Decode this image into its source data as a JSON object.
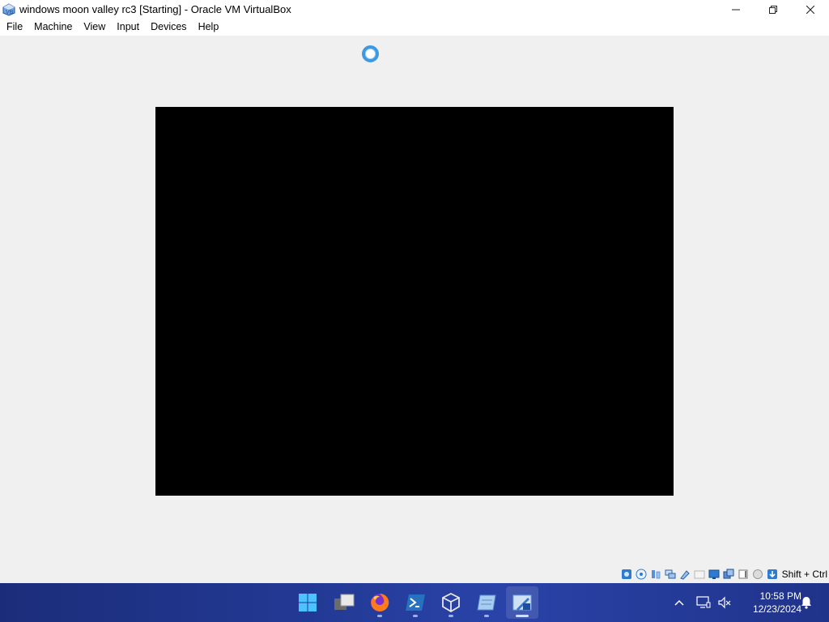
{
  "window": {
    "title": "windows moon valley rc3 [Starting] - Oracle VM VirtualBox",
    "app_icon": "virtualbox-icon",
    "minimize": "minimize-icon",
    "maximize": "restore-icon",
    "close": "close-icon"
  },
  "menu": {
    "items": [
      "File",
      "Machine",
      "View",
      "Input",
      "Devices",
      "Help"
    ]
  },
  "vm": {
    "screen_color": "#000000",
    "status": "loading-spinner"
  },
  "statusbar": {
    "indicators": [
      "hard-disk-icon",
      "optical-drive-icon",
      "audio-icon",
      "network-icon",
      "usb-icon",
      "shared-folders-icon",
      "display-icon",
      "recording-icon",
      "cpu-icon",
      "mouse-integration-icon",
      "host-key-icon"
    ],
    "host_key": "Shift + Ctrl"
  },
  "taskbar": {
    "apps": [
      "windows-start-icon",
      "task-view-icon",
      "firefox-icon",
      "powershell-icon",
      "virtualbox-manager-icon",
      "notes-app-icon",
      "virtualbox-vm-icon"
    ],
    "active_app": "virtualbox-vm-icon",
    "tray": [
      "show-hidden-icons-icon",
      "display-tray-icon",
      "volume-muted-icon",
      "notifications-icon"
    ],
    "time": "10:58 PM",
    "date": "12/23/2024",
    "colors": {
      "taskbar": "#233a96",
      "accent": "#3b9ae1"
    }
  }
}
